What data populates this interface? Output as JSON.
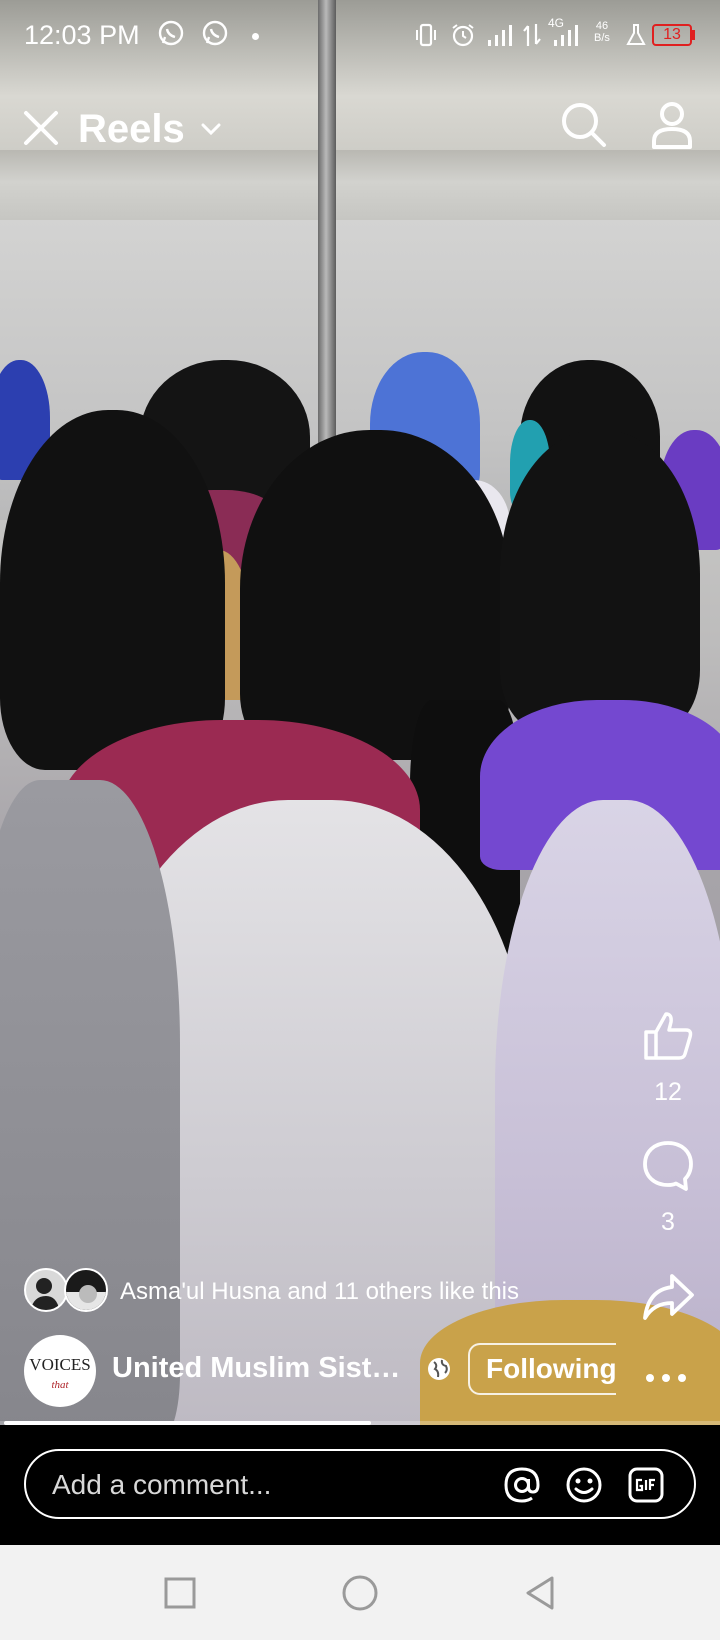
{
  "status_bar": {
    "time": "12:03 PM",
    "network_type": "4G",
    "net_speed_value": "46",
    "net_speed_unit": "B/s",
    "battery": "13"
  },
  "header": {
    "title": "Reels"
  },
  "actions": {
    "like_count": "12",
    "comment_count": "3"
  },
  "post": {
    "likes_text": "Asma'ul Husna and 11 others like this",
    "page_name": "United Muslim Sister...",
    "avatar_logo_text": "VOICES",
    "avatar_logo_sub": "that",
    "follow_label": "Following",
    "progress_fraction": 0.51
  },
  "comment": {
    "placeholder": "Add a comment..."
  },
  "colors": {
    "battery_low": "#e02020",
    "overlay_text": "#ffffff"
  }
}
